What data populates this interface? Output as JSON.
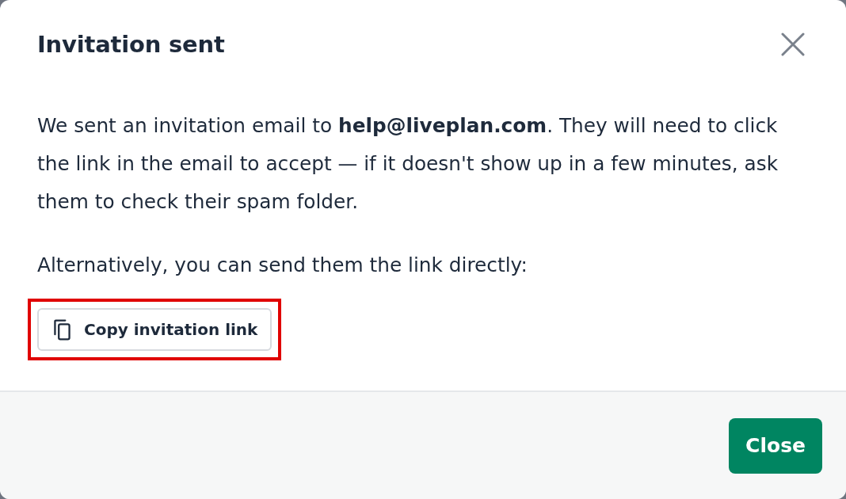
{
  "dialog": {
    "title": "Invitation sent"
  },
  "body": {
    "paragraphs": [
      "We sent an invitation email to **help@liveplan.com**. They will need to click the link in the email to accept — if it doesn't show up in a few minutes, ask them to check their spam folder.",
      "Alternatively, you can send them the link directly:"
    ],
    "copy_button": {
      "label": "Copy invitation link",
      "highlighted": true
    }
  },
  "footer": {
    "buttons": [
      "Close"
    ]
  }
}
